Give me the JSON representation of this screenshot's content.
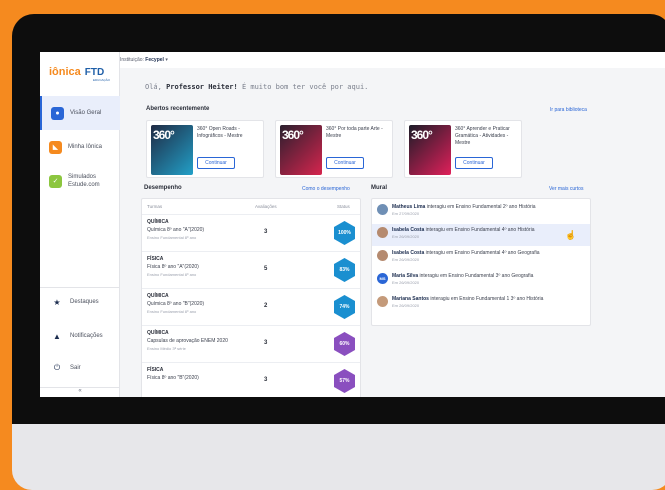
{
  "brand": {
    "name": "iônica",
    "partner": "FTD",
    "partner_sub": "EDUCAÇÃO",
    "accent": "#f58a1f",
    "primary": "#2a66d6"
  },
  "topbar": {
    "prefix": "Instituição:",
    "institution": "Fecypel"
  },
  "greeting": {
    "prefix": "Olá,",
    "name": "Professor Heiter!",
    "message": "É muito bom ter você por aqui."
  },
  "sidebar": {
    "items": [
      {
        "label": "Visão Geral",
        "icon": "eye-icon"
      },
      {
        "label": "Minha Iônica",
        "icon": "ionica-icon"
      },
      {
        "label": "Simulados",
        "label2": "Estude.com",
        "icon": "simulados-icon"
      }
    ],
    "bottom": [
      {
        "label": "Destaques",
        "icon": "star-icon"
      },
      {
        "label": "Notificações",
        "icon": "bell-icon"
      },
      {
        "label": "Sair",
        "icon": "power-icon"
      }
    ],
    "collapse": "«"
  },
  "recent": {
    "title": "Abertos recentemente",
    "link": "Ir para biblioteca",
    "cards": [
      {
        "cover": "360°",
        "title": "360° Open Roads - Infográficos - Mestre",
        "button": "Continuar"
      },
      {
        "cover": "360°",
        "title": "360° Por toda parte Arte - Mestre",
        "button": "Continuar"
      },
      {
        "cover": "360°",
        "title": "360° Aprender e Praticar Gramática - Atividades - Mestre",
        "button": "Continuar"
      }
    ]
  },
  "performance": {
    "title": "Desempenho",
    "link": "Como o desempenho",
    "headers": [
      "Turmas",
      "Avaliações",
      "Status"
    ],
    "rows": [
      {
        "subject": "QUÍMICA",
        "class": "Química 8º ano \"A\"(2020)",
        "level": "Ensino Fundamental 8º ano",
        "count": "3",
        "status": "100%",
        "color": "#1a8fd0"
      },
      {
        "subject": "FÍSICA",
        "class": "Física 8º ano \"A\"(2020)",
        "level": "Ensino Fundamental 8º ano",
        "count": "5",
        "status": "83%",
        "color": "#1a8fd0"
      },
      {
        "subject": "QUÍMICA",
        "class": "Química 8º ano \"B\"(2020)",
        "level": "Ensino Fundamental 8º ano",
        "count": "2",
        "status": "74%",
        "color": "#1a8fd0"
      },
      {
        "subject": "QUÍMICA",
        "class": "Capsulas de aprovação ENEM 2020",
        "level": "Ensino Médio 3ª série",
        "count": "3",
        "status": "60%",
        "color": "#8a4fbf"
      },
      {
        "subject": "FÍSICA",
        "class": "Física 8º ano \"B\"(2020)",
        "level": "",
        "count": "3",
        "status": "57%",
        "color": "#8a4fbf"
      }
    ]
  },
  "mural": {
    "title": "Mural",
    "link": "Ver mais curtos",
    "items": [
      {
        "name": "Matheus Lima",
        "action": "interagiu em Ensino Fundamental 2º ano História",
        "date": "Em 27/09/2020",
        "avatar": "",
        "color": "#6f8fb5"
      },
      {
        "name": "Isabela Costa",
        "action": "interagiu em Ensino Fundamental 4º ano História",
        "date": "Em 26/09/2020",
        "avatar": "",
        "color": "#b58a6f",
        "highlight": true
      },
      {
        "name": "Isabela Costa",
        "action": "interagiu em Ensino Fundamental 4º ano Geografia",
        "date": "Em 26/09/2020",
        "avatar": "",
        "color": "#b58a6f"
      },
      {
        "name": "Maria Silva",
        "action": "interagiu em Ensino Fundamental 3º ano Geografia",
        "date": "Em 26/09/2020",
        "avatar": "MS",
        "color": "#2a66d6"
      },
      {
        "name": "Mariana Santos",
        "action": "interagiu em Ensino Fundamental 1 3º ano História",
        "date": "Em 26/09/2020",
        "avatar": "",
        "color": "#c49a7a"
      }
    ]
  }
}
